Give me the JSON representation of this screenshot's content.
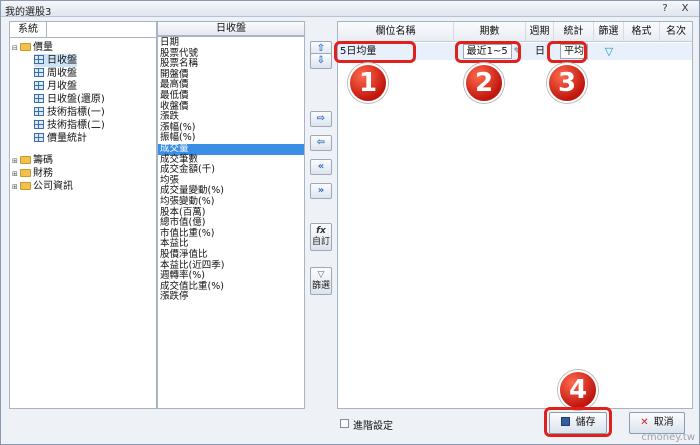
{
  "window": {
    "title": "我的選股3",
    "help": "?",
    "close": "X"
  },
  "tree": {
    "tab": "系統",
    "nodes": [
      {
        "label": "價量",
        "icon": "folder-icon",
        "expander": "⊟"
      },
      {
        "label": "日收盤",
        "icon": "grid-icon"
      },
      {
        "label": "周收盤",
        "icon": "grid-icon"
      },
      {
        "label": "月收盤",
        "icon": "grid-icon"
      },
      {
        "label": "日收盤(還原)",
        "icon": "grid-icon"
      },
      {
        "label": "技術指標(一)",
        "icon": "grid-icon"
      },
      {
        "label": "技術指標(二)",
        "icon": "grid-icon"
      },
      {
        "label": "價量統計",
        "icon": "grid-icon"
      },
      {
        "label": "籌碼",
        "icon": "folder-icon",
        "expander": "⊞"
      },
      {
        "label": "財務",
        "icon": "folder-icon",
        "expander": "⊞"
      },
      {
        "label": "公司資訊",
        "icon": "folder-icon",
        "expander": "⊞"
      }
    ]
  },
  "fields": {
    "header": "日收盤",
    "items": [
      "日期",
      "股票代號",
      "股票名稱",
      "開盤價",
      "最高價",
      "最低價",
      "收盤價",
      "漲跌",
      "漲幅(%)",
      "振幅(%)",
      "成交量",
      "成交筆數",
      "成交金額(千)",
      "均張",
      "成交量變動(%)",
      "均張變動(%)",
      "股本(百萬)",
      "總市值(億)",
      "市值比重(%)",
      "本益比",
      "股價淨值比",
      "本益比(近四季)",
      "週轉率(%)",
      "成交值比重(%)",
      "漲跌停"
    ],
    "selected_index": 10
  },
  "mid_buttons": {
    "up": "⇧",
    "down": "⇩",
    "add": "⇨",
    "remove": "⇦",
    "remove_all": "«",
    "add_all": "»",
    "custom_icon": "fx",
    "custom": "自訂",
    "filter": "篩選"
  },
  "grid": {
    "headers": [
      "欄位名稱",
      "期數",
      "週期",
      "統計",
      "篩選",
      "格式",
      "名次"
    ],
    "row": {
      "name": "5日均量",
      "period": "最近1~5",
      "cycle": "日",
      "stat": "平均"
    }
  },
  "badges": [
    "1",
    "2",
    "3",
    "4"
  ],
  "footer": {
    "advanced": "進階設定",
    "save": "儲存",
    "cancel": "取消"
  },
  "watermark": "cmoney.tw",
  "colors": {
    "highlight": "#e0211b",
    "selection": "#3a8ee6"
  }
}
